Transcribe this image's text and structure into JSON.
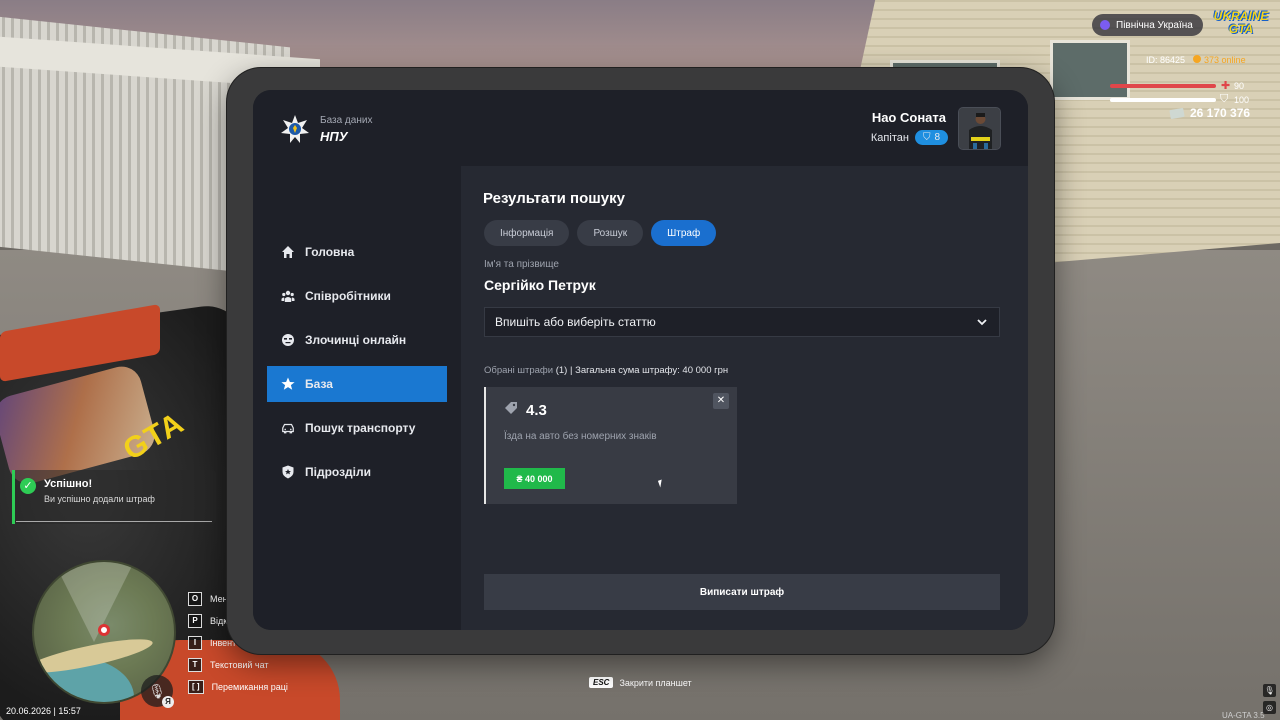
{
  "hud": {
    "region": "Північна Україна",
    "logo_line1": "UKRAINE",
    "logo_line2": "GTA",
    "id_text": "ID: 86425",
    "online_text": "373 online",
    "health": "90",
    "armor": "100",
    "money": "26 170 376",
    "health_color": "#e0464a",
    "armor_color": "#ffffff"
  },
  "toast": {
    "title": "Успішно!",
    "text": "Ви успішно додали штраф"
  },
  "hints": [
    {
      "key": "O",
      "label": "Мен"
    },
    {
      "key": "P",
      "label": "Відк"
    },
    {
      "key": "I",
      "label": "Інвент"
    },
    {
      "key": "T",
      "label": "Текстовий чат"
    },
    {
      "key": "[ ]",
      "label": "Перемикання раці"
    }
  ],
  "datetime": "20.06.2026 | 15:57",
  "esc": {
    "key": "ESC",
    "label": "Закрити планшет"
  },
  "version": "UA-GTA 3.5",
  "tablet": {
    "brand_sub": "База даних",
    "brand_title": "НПУ",
    "nav": [
      {
        "label": "Головна",
        "icon": "home-icon",
        "active": false
      },
      {
        "label": "Співробітники",
        "icon": "users-icon",
        "active": false
      },
      {
        "label": "Злочинці онлайн",
        "icon": "criminal-icon",
        "active": false
      },
      {
        "label": "База",
        "icon": "star-icon",
        "active": true
      },
      {
        "label": "Пошук транспорту",
        "icon": "car-icon",
        "active": false
      },
      {
        "label": "Підрозділи",
        "icon": "shield-icon",
        "active": false
      }
    ],
    "user": {
      "name": "Нао Соната",
      "rank": "Капітан",
      "rank_level": "8"
    },
    "results_title": "Результати пошуку",
    "tabs": [
      {
        "label": "Інформація",
        "active": false
      },
      {
        "label": "Розшук",
        "active": false
      },
      {
        "label": "Штраф",
        "active": true
      }
    ],
    "name_label": "Ім'я та прізвище",
    "person": "Сергійко Петрук",
    "select_placeholder": "Впишіть або виберіть статтю",
    "summary": {
      "label": "Обрані штрафи",
      "count": "(1)",
      "total": "| Загальна сума штрафу: 40 000 грн"
    },
    "fine": {
      "code": "4.3",
      "description": "Їзда на авто без номерних знаків",
      "amount": "₴ 40 000"
    },
    "submit_label": "Виписати штраф"
  }
}
